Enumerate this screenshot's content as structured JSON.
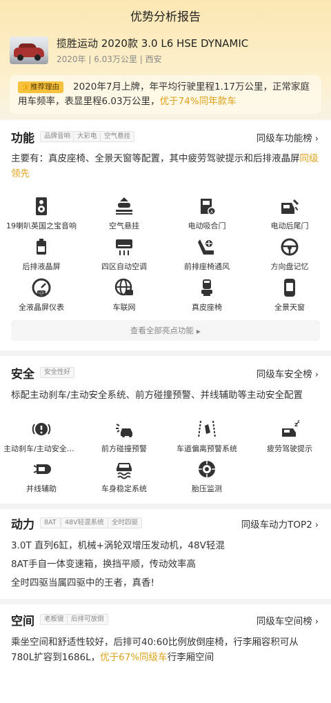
{
  "header": {
    "title": "优势分析报告"
  },
  "car": {
    "name": "揽胜运动 2020款 3.0 L6 HSE DYNAMIC",
    "meta": "2020年 | 6.03万公里 | 西安"
  },
  "recommend": {
    "tag": "推荐理由",
    "text": "2020年7月上牌，年平均行驶里程1.17万公里，正常家庭用车频率，表显里程6.03万公里，",
    "highlight": "优于74%同年款车"
  },
  "function": {
    "title": "功能",
    "tags": [
      "品牌音响",
      "大彩电",
      "空气悬挂"
    ],
    "rank": "同级车功能榜",
    "desc": "主要有：真皮座椅、全景天窗等配置，其中疲劳驾驶提示和后排液晶屏",
    "desc_highlight": "同级领先",
    "items": [
      {
        "label": "19喇叭英国之宝音响",
        "icon": "speaker-icon"
      },
      {
        "label": "空气悬挂",
        "icon": "air-suspension-icon"
      },
      {
        "label": "电动吸合门",
        "icon": "soft-close-door-icon"
      },
      {
        "label": "电动后尾门",
        "icon": "power-tailgate-icon"
      },
      {
        "label": "后排液晶屏",
        "icon": "rear-screen-icon"
      },
      {
        "label": "四区自动空调",
        "icon": "air-conditioner-icon"
      },
      {
        "label": "前排座椅通风",
        "icon": "seat-ventilation-icon"
      },
      {
        "label": "方向盘记忆",
        "icon": "steering-wheel-icon"
      },
      {
        "label": "全液晶屏仪表",
        "icon": "lcd-gauge-icon"
      },
      {
        "label": "车联网",
        "icon": "connected-car-icon"
      },
      {
        "label": "真皮座椅",
        "icon": "leather-seat-icon"
      },
      {
        "label": "全景天窗",
        "icon": "panoramic-sunroof-icon"
      }
    ],
    "see_all": "查看全部亮点功能"
  },
  "safety": {
    "title": "安全",
    "tags": [
      "安全性好"
    ],
    "rank": "同级车安全榜",
    "desc": "标配主动刹车/主动安全系统、前方碰撞预警、并线辅助等主动安全配置",
    "items": [
      {
        "label": "主动刹车/主动安全系统",
        "icon": "active-brake-icon"
      },
      {
        "label": "前方碰撞预警",
        "icon": "collision-warning-icon"
      },
      {
        "label": "车道偏离预警系统",
        "icon": "lane-departure-icon"
      },
      {
        "label": "疲劳驾驶提示",
        "icon": "fatigue-alert-icon"
      },
      {
        "label": "并线辅助",
        "icon": "blind-spot-icon"
      },
      {
        "label": "车身稳定系统",
        "icon": "stability-control-icon"
      },
      {
        "label": "胎压监测",
        "icon": "tire-pressure-icon"
      }
    ]
  },
  "power": {
    "title": "动力",
    "tags": [
      "8AT",
      "48V轻混系统",
      "全时四驱"
    ],
    "rank": "同级车动力TOP2",
    "lines": [
      "3.0T 直列6缸，机械+涡轮双增压发动机，48V轻混",
      "8AT手自一体变速箱，换挡平顺，传动效率高",
      "全时四驱当属四驱中的王者，真香!"
    ]
  },
  "space": {
    "title": "空间",
    "tags": [
      "老板键",
      "后排可放倒"
    ],
    "rank": "同级车空间榜",
    "desc": "乘坐空间和舒适性较好，后排可40:60比例放倒座椅，行李厢容积可从780L扩容到1686L，",
    "desc_highlight": "优于67%同级车",
    "desc_tail": "行李厢空间"
  }
}
